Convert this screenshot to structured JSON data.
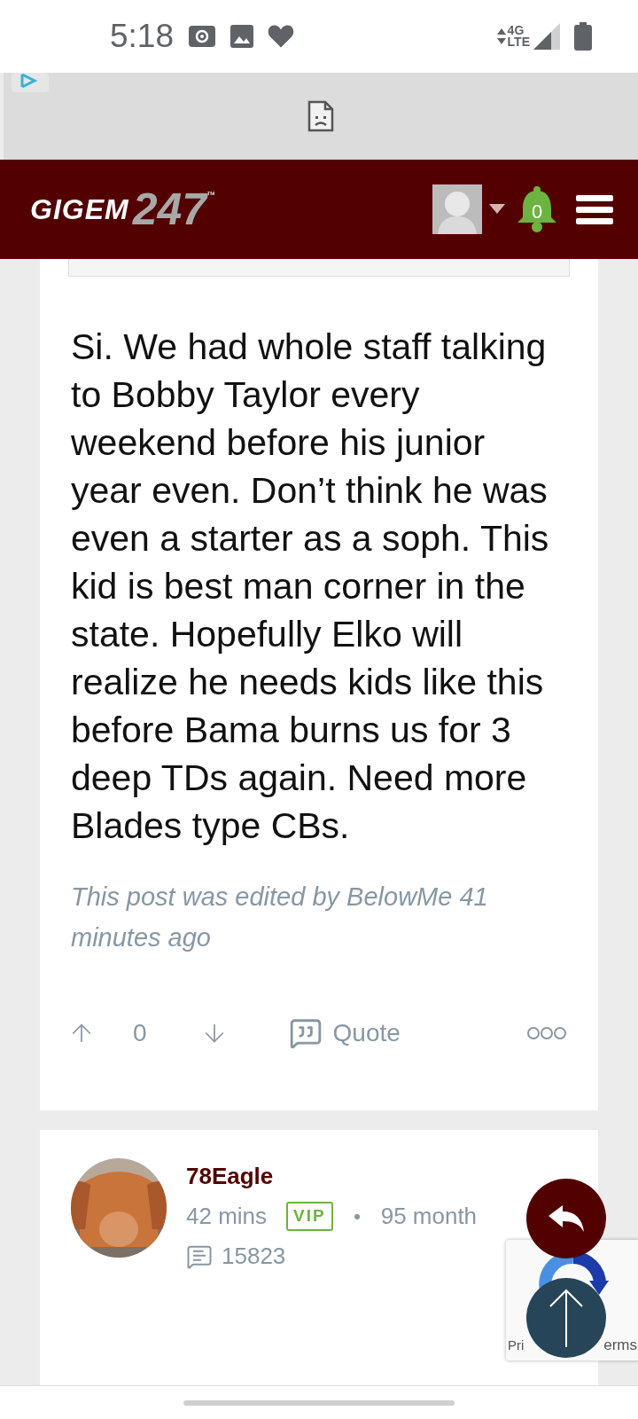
{
  "status_bar": {
    "time": "5:18",
    "network_top": "4G",
    "network_bottom": "LTE"
  },
  "header": {
    "logo_word": "GIGEM",
    "logo_number": "247",
    "logo_mark": "™",
    "notifications": "0"
  },
  "post": {
    "body": "Si. We had whole staff talking to Bobby Taylor every weekend before his junior year even. Don’t think he was even a starter as a soph. This kid is best man corner in the state. Hopefully Elko will realize he needs kids like this before Bama burns us for 3 deep TDs again. Need more Blades type CBs.",
    "edited_note": "This post was edited by BelowMe 41 minutes ago",
    "votes": "0",
    "quote_label": "Quote"
  },
  "next_post": {
    "username": "78Eagle",
    "time": "42 mins",
    "badge": "VIP",
    "tenure": "95 month",
    "post_count": "15823"
  },
  "recaptcha": {
    "left_text": "Pri",
    "right_text": "erms"
  }
}
